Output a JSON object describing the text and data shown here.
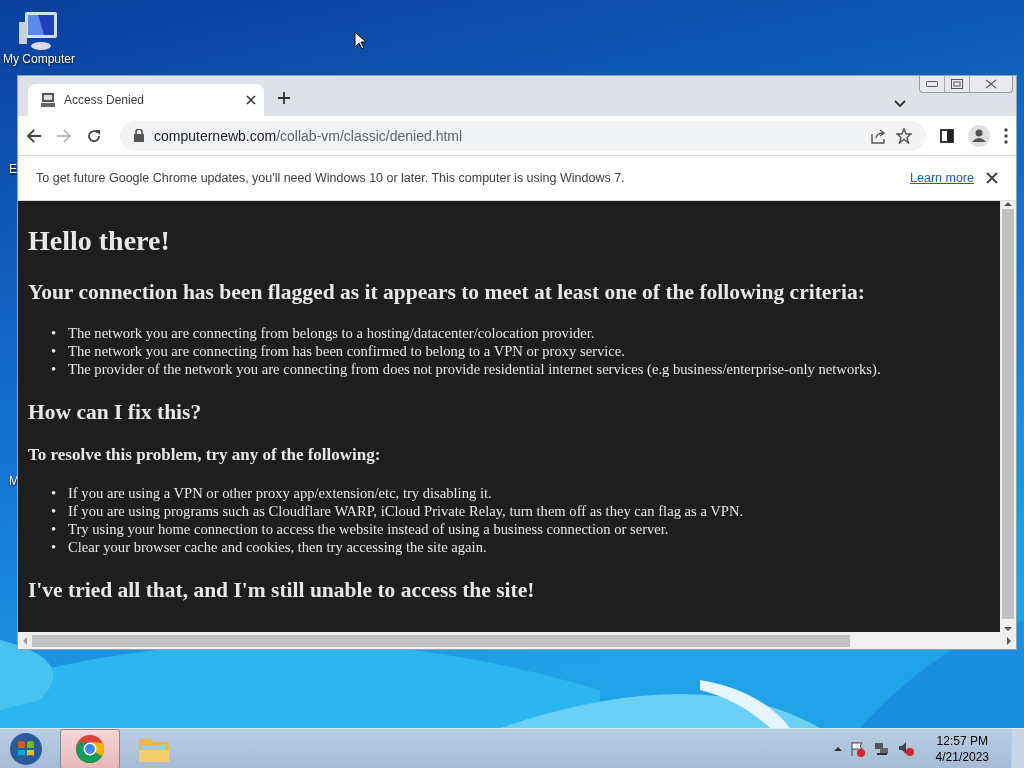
{
  "desktop": {
    "icons": [
      {
        "label": "My Computer"
      }
    ],
    "partial_labels": [
      {
        "text": "E"
      },
      {
        "text": "M"
      }
    ]
  },
  "browser": {
    "tabs": [
      {
        "title": "Access Denied",
        "selected": true
      }
    ],
    "nav": {
      "forward": {
        "disabled": true
      }
    },
    "url": {
      "host": "computernewb.com",
      "path": "/collab-vm/classic/denied.html"
    },
    "infobar": {
      "message": "To get future Google Chrome updates, you'll need Windows 10 or later. This computer is using Windows 7.",
      "link": "Learn more"
    },
    "page": {
      "blocks": [
        {
          "kind": "h1",
          "text": "Hello there!"
        },
        {
          "kind": "h2",
          "text": "Your connection has been flagged as it appears to meet at least one of the following criteria:"
        },
        {
          "kind": "list",
          "marker": "•",
          "items": [
            "The network you are connecting from belongs to a hosting/datacenter/colocation provider.",
            "The network you are connecting from has been confirmed to belong to a VPN or proxy service.",
            "The provider of the network you are connecting from does not provide residential internet services (e.g business/enterprise-only networks)."
          ]
        },
        {
          "kind": "h2",
          "text": "How can I fix this?"
        },
        {
          "kind": "h3",
          "text": "To resolve this problem, try any of the following:"
        },
        {
          "kind": "list",
          "marker": "•",
          "items": [
            "If you are using a VPN or other proxy app/extension/etc, try disabling it.",
            "If you are using programs such as Cloudflare WARP, iCloud Private Relay, turn them off as they can flag as a VPN.",
            "Try using your home connection to access the website instead of using a business connection or server.",
            "Clear your browser cache and cookies, then try accessing the site again."
          ]
        },
        {
          "kind": "h2",
          "text": "I've tried all that, and I'm still unable to access the site!"
        }
      ]
    }
  },
  "taskbar": {
    "apps": [
      {
        "kind": "browser",
        "selected": true
      },
      {
        "kind": "folder",
        "selected": false
      }
    ],
    "clock": {
      "time": "12:57 PM",
      "date": "4/21/2023"
    }
  }
}
